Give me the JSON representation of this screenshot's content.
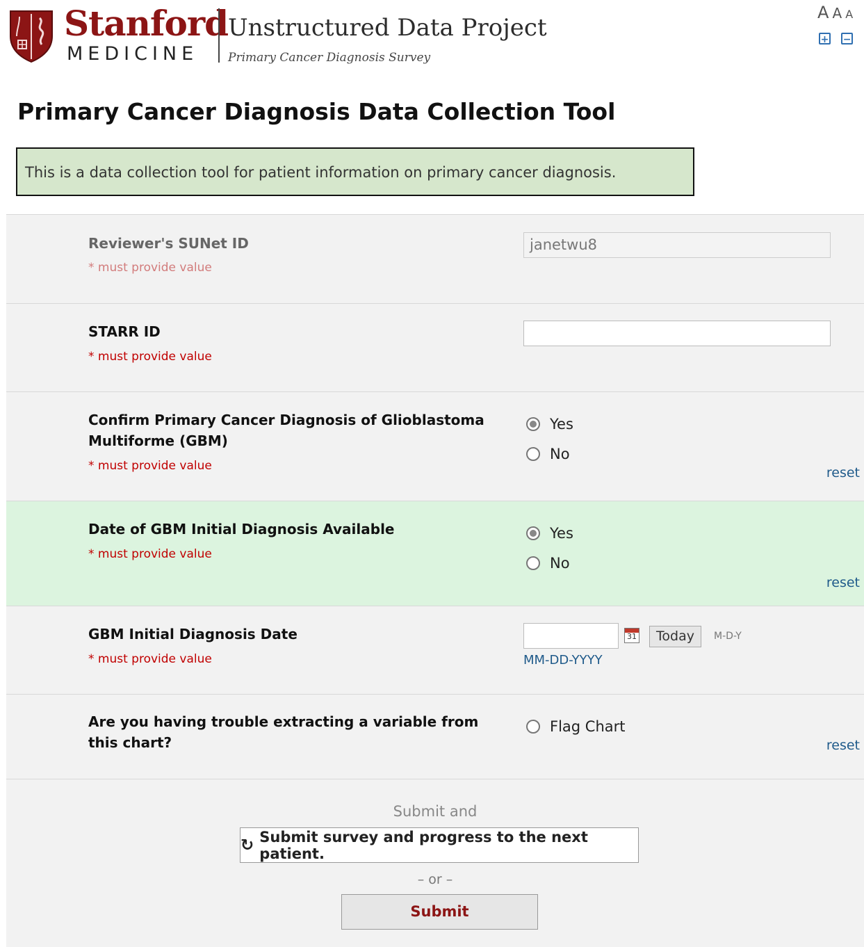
{
  "header": {
    "brand_name": "Stanford",
    "brand_sub": "MEDICINE",
    "project_title": "Unstructured Data Project",
    "project_subtitle": "Primary Cancer Diagnosis Survey",
    "font_sizes": [
      "A",
      "A",
      "A"
    ],
    "zoom_in_glyph": "+",
    "zoom_out_glyph": "−"
  },
  "page": {
    "title": "Primary Cancer Diagnosis Data Collection Tool",
    "intro": "This is a data collection tool for patient information on primary cancer diagnosis."
  },
  "fields": {
    "reviewer": {
      "label": "Reviewer's SUNet ID",
      "required": "must provide value",
      "value": "janetwu8"
    },
    "starr": {
      "label": "STARR ID",
      "required": "must provide value",
      "value": ""
    },
    "confirm_gbm": {
      "label": "Confirm Primary Cancer Diagnosis of Glioblastoma Multiforme (GBM)",
      "required": "must provide value",
      "options": [
        "Yes",
        "No"
      ],
      "selected": "Yes",
      "reset": "reset"
    },
    "date_available": {
      "label": "Date of GBM Initial Diagnosis Available",
      "required": "must provide value",
      "options": [
        "Yes",
        "No"
      ],
      "selected": "Yes",
      "reset": "reset"
    },
    "diagnosis_date": {
      "label": "GBM Initial Diagnosis Date",
      "required": "must provide value",
      "value": "",
      "calendar_day": "31",
      "today_label": "Today",
      "format_short": "M-D-Y",
      "format_hint": "MM-DD-YYYY"
    },
    "trouble": {
      "label": "Are you having trouble extracting a variable from this chart?",
      "option": "Flag Chart",
      "reset": "reset"
    }
  },
  "submit": {
    "submit_and": "Submit and",
    "next_button": "Submit survey and progress to the next patient.",
    "or_text": "– or –",
    "submit_button": "Submit"
  },
  "colors": {
    "brand": "#8c1515",
    "required": "#c00000",
    "link": "#1f5a8a",
    "highlight_row": "#dcf4df",
    "intro_box": "#d6e7cc"
  },
  "icons": {
    "shield": "stanford-shield-icon",
    "calendar": "calendar-icon",
    "refresh": "refresh-icon"
  }
}
